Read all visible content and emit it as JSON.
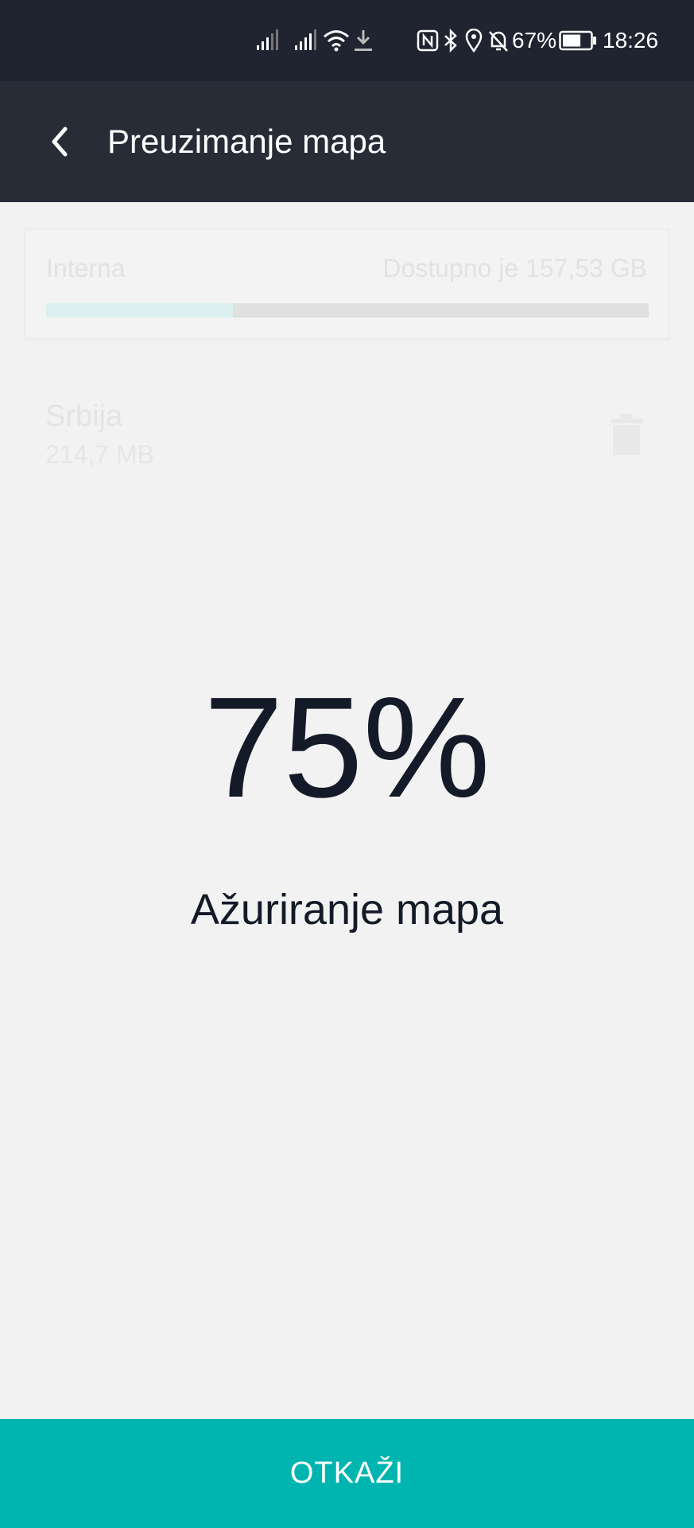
{
  "status_bar": {
    "battery_percent": "67%",
    "time": "18:26",
    "icons": [
      "signal-icon",
      "signal-icon",
      "wifi-icon",
      "download-icon",
      "nfc-icon",
      "bluetooth-icon",
      "location-icon",
      "alarm-off-icon",
      "battery-icon"
    ],
    "battery_level": 0.67
  },
  "app_bar": {
    "title": "Preuzimanje mapa",
    "back_icon": "chevron-left-icon"
  },
  "storage": {
    "label": "Interna",
    "available": "Dostupno je 157,53 GB",
    "used_fraction": 0.31
  },
  "map_item": {
    "name": "Srbija",
    "size": "214,7 MB",
    "delete_icon": "trash-icon"
  },
  "progress": {
    "percent": "75%",
    "label": "Ažuriranje mapa"
  },
  "cancel_button": {
    "label": "OTKAŽI"
  },
  "colors": {
    "status_bar": "#1f2430",
    "app_bar": "#272c36",
    "background": "#f2f2f2",
    "accent": "#00b5b0",
    "text_dark": "#141a28"
  }
}
